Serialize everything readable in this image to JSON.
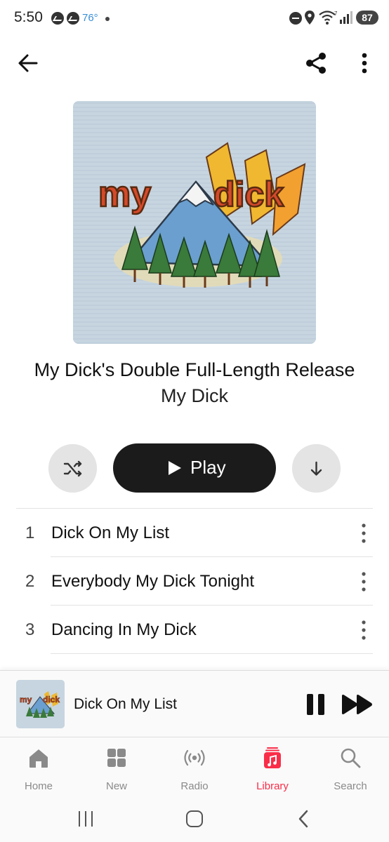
{
  "status_bar": {
    "time": "5:50",
    "temperature": "76°",
    "battery": "87",
    "icons": [
      "messenger-icon",
      "messenger-icon",
      "dot-icon",
      "do-not-disturb-icon",
      "location-icon",
      "wifi-icon",
      "signal-icon",
      "battery-icon"
    ]
  },
  "header": {
    "back_icon": "arrow-left-icon",
    "share_icon": "share-icon",
    "more_icon": "more-vertical-icon"
  },
  "album": {
    "title": "My Dick's Double Full-Length Release",
    "artist": "My Dick",
    "artwork_text": "my dick"
  },
  "actions": {
    "shuffle_icon": "shuffle-icon",
    "play_label": "Play",
    "download_icon": "download-arrow-icon"
  },
  "tracks": [
    {
      "number": "1",
      "title": "Dick On My List"
    },
    {
      "number": "2",
      "title": "Everybody My Dick Tonight"
    },
    {
      "number": "3",
      "title": "Dancing In My Dick"
    }
  ],
  "now_playing": {
    "title": "Dick On My List",
    "artwork_text": "my dick"
  },
  "tab_bar": {
    "tabs": [
      {
        "label": "Home",
        "icon": "home-icon",
        "active": false
      },
      {
        "label": "New",
        "icon": "grid-icon",
        "active": false
      },
      {
        "label": "Radio",
        "icon": "radio-broadcast-icon",
        "active": false
      },
      {
        "label": "Library",
        "icon": "music-library-icon",
        "active": true
      },
      {
        "label": "Search",
        "icon": "search-icon",
        "active": false
      }
    ]
  },
  "colors": {
    "accent": "#fa2d48",
    "play_button": "#1b1b1b",
    "secondary_button": "#e4e4e4",
    "inactive_tab": "#8a8a8a"
  }
}
